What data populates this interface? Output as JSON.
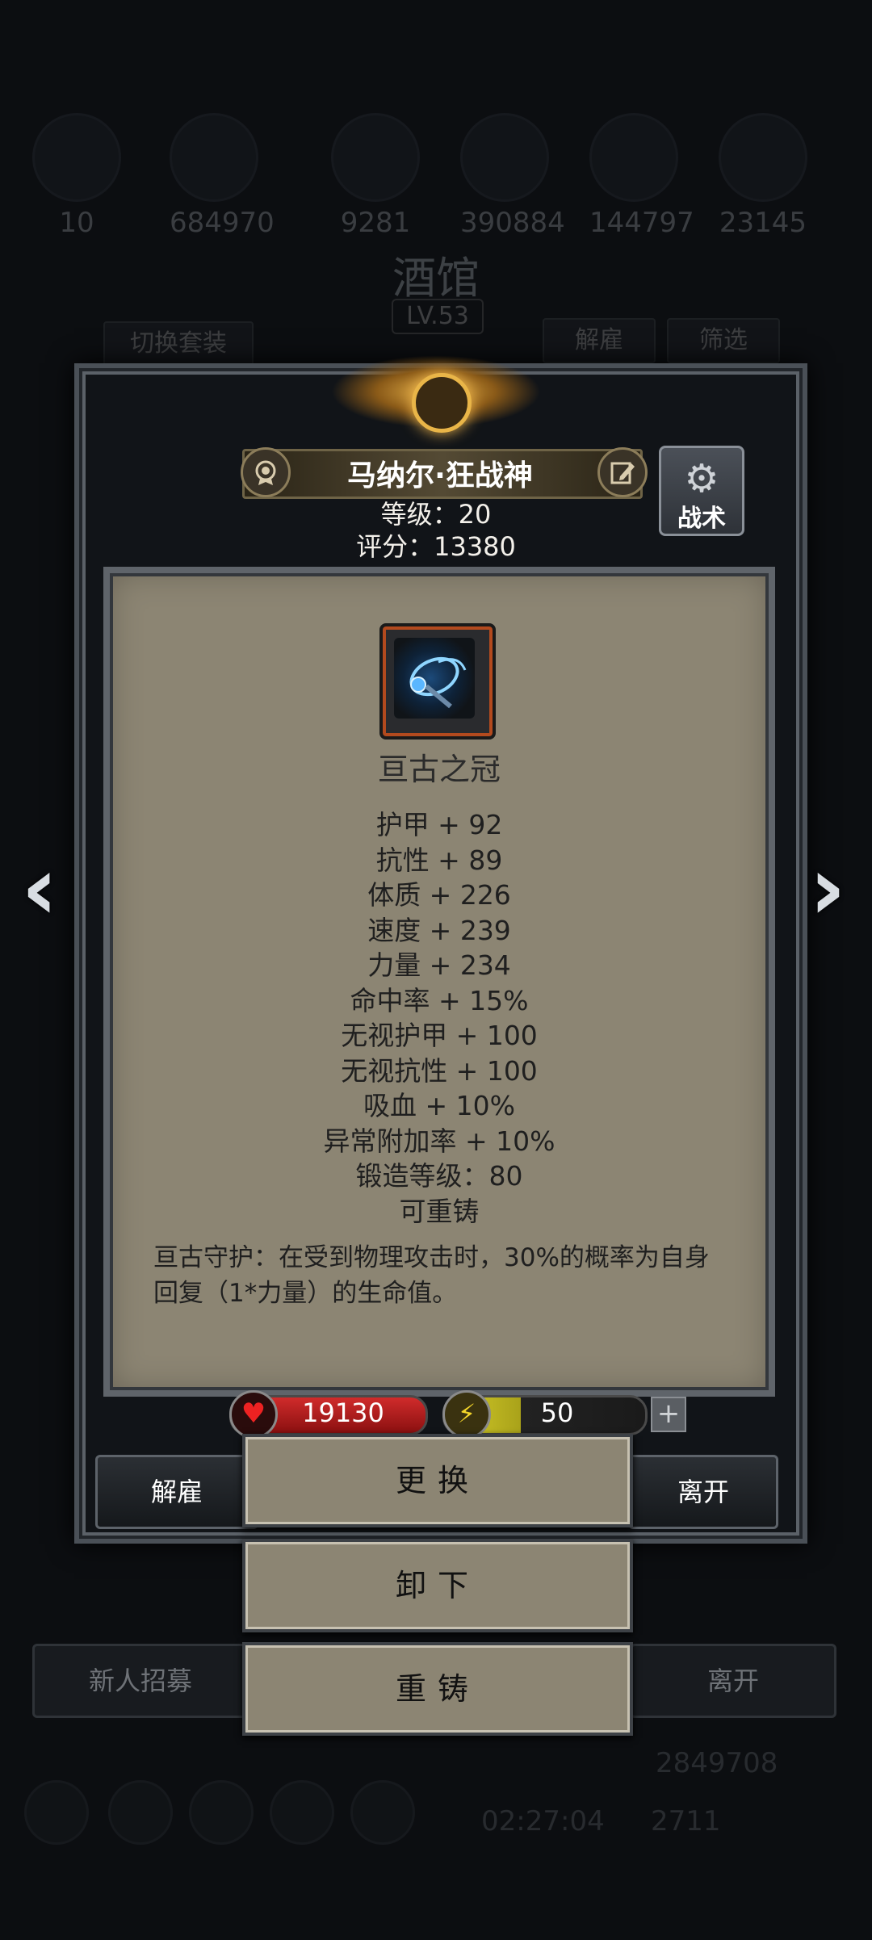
{
  "background": {
    "resources": [
      "10",
      "684970",
      "9281",
      "390884",
      "144797",
      "23145"
    ],
    "title": "酒馆",
    "level": "LV.53",
    "switch_outfit": "切换套装",
    "dismiss": "解雇",
    "filter": "筛选",
    "recruit": "新人招募",
    "leave": "离开",
    "gold": "2849708",
    "timer": "02:27:04",
    "gems": "2711"
  },
  "hero": {
    "name": "马纳尔·狂战神",
    "level_label": "等级：20",
    "score_label": "评分：13380",
    "tactics_label": "战术"
  },
  "item": {
    "name": "亘古之冠",
    "stats": [
      "护甲 + 92",
      "抗性 + 89",
      "体质 + 226",
      "速度 + 239",
      "力量 + 234",
      "命中率 + 15%",
      "无视护甲 + 100",
      "无视抗性 + 100",
      "吸血 + 10%",
      "异常附加率 + 10%",
      "锻造等级：80",
      "可重铸"
    ],
    "description": "亘古守护：在受到物理攻击时，30%的概率为自身回复（1*力量）的生命值。"
  },
  "bars": {
    "hp": "19130",
    "energy": "50",
    "energy_fill_fraction": 0.38
  },
  "buttons": {
    "dismiss": "解雇",
    "leave": "离开",
    "replace": "更换",
    "unequip": "卸下",
    "reforge": "重铸",
    "plus": "+"
  },
  "colors": {
    "parchment": "#8c8573",
    "hp_red": "#d02b2b",
    "energy_yellow": "#d8d02a",
    "gold_glow": "#e9b548"
  }
}
